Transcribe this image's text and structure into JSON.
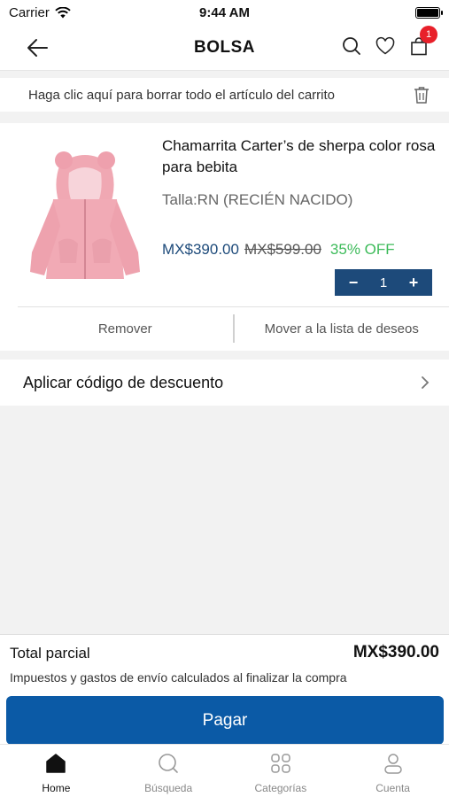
{
  "status_bar": {
    "carrier": "Carrier",
    "time": "9:44 AM"
  },
  "header": {
    "title": "BOLSA",
    "cart_count": "1",
    "icons": [
      "back-arrow-icon",
      "search-icon",
      "heart-icon",
      "bag-icon"
    ]
  },
  "clear_cart": {
    "label": "Haga clic aquí para borrar todo el artículo del carrito",
    "icon": "trash-icon"
  },
  "cart_item": {
    "name": "Chamarrita Carter’s de sherpa color rosa para bebita",
    "size": "Talla:RN (RECIÉN NACIDO)",
    "price": "MX$390.00",
    "original_price": "MX$599.00",
    "discount": "35% OFF",
    "quantity": "1",
    "decrement_label": "−",
    "increment_label": "+",
    "remove_label": "Remover",
    "wishlist_label": "Mover a la lista de deseos"
  },
  "discount_code": {
    "label": "Aplicar código de descuento"
  },
  "summary": {
    "subtotal_label": "Total parcial",
    "subtotal_value": "MX$390.00",
    "tax_note": "Impuestos y gastos de envío calculados al finalizar la compra",
    "pay_label": "Pagar"
  },
  "tab_bar": {
    "items": [
      {
        "label": "Home",
        "icon": "home-icon",
        "active": true
      },
      {
        "label": "Búsqueda",
        "icon": "search-icon",
        "active": false
      },
      {
        "label": "Categorías",
        "icon": "grid-icon",
        "active": false
      },
      {
        "label": "Cuenta",
        "icon": "user-icon",
        "active": false
      }
    ]
  },
  "colors": {
    "accent": "#1d4a7a",
    "pay_button": "#0b5aa6",
    "discount_green": "#3dbb5a",
    "badge_red": "#e8202a"
  }
}
